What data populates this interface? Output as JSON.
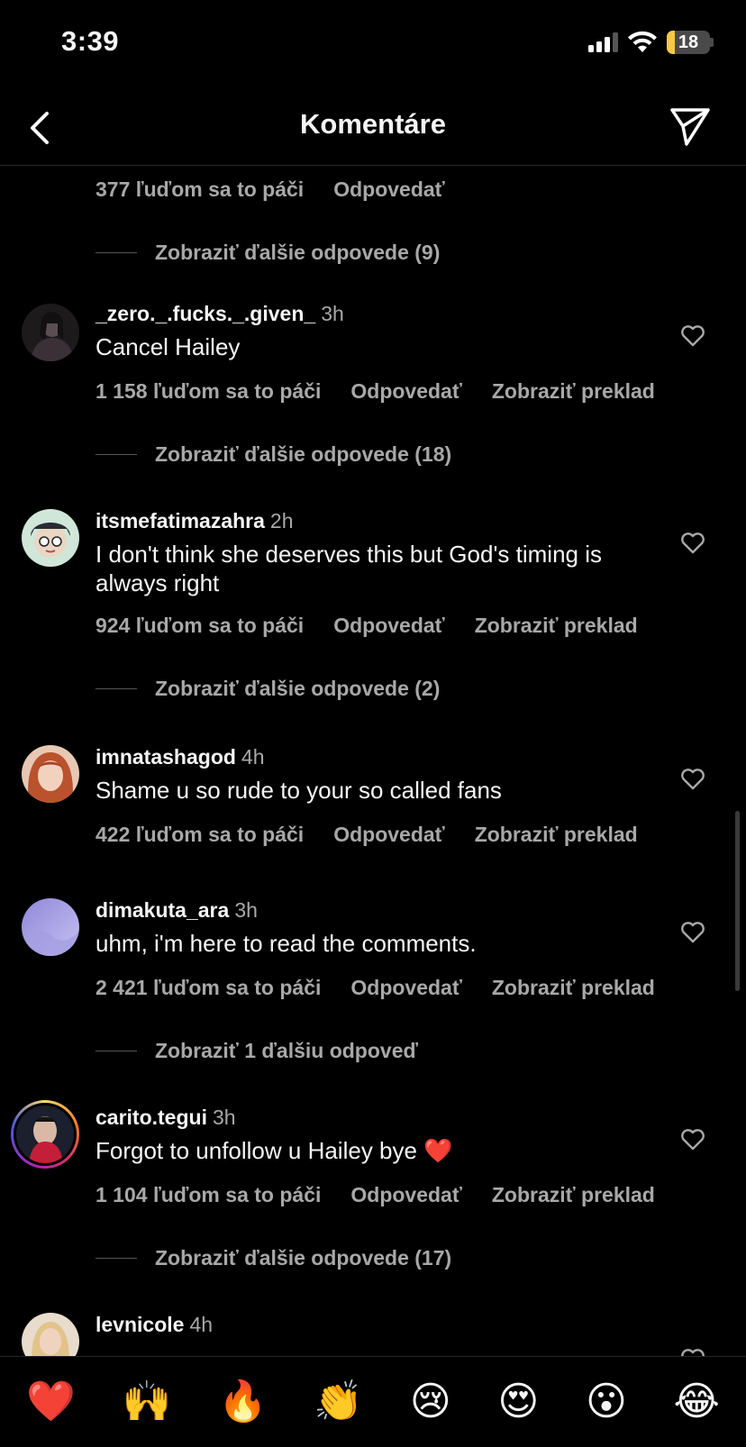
{
  "status": {
    "time": "3:39",
    "battery": "18",
    "battery_level": 0.18,
    "signal_bars": 3
  },
  "header": {
    "title": "Komentáre",
    "back_icon": "chevron-left-icon",
    "send_icon": "paper-plane-icon"
  },
  "top_meta": {
    "likes": "377 ľuďom sa to páči",
    "reply": "Odpovedať"
  },
  "top_more": "Zobraziť ďalšie odpovede (9)",
  "comments": [
    {
      "username": "_zero._.fucks._.given_",
      "time": "3h",
      "text": "Cancel Hailey",
      "likes": "1 158 ľuďom sa to páči",
      "reply": "Odpovedať",
      "translate": "Zobraziť preklad",
      "more_replies": "Zobraziť ďalšie odpovede (18)"
    },
    {
      "username": "itsmefatimazahra",
      "time": "2h",
      "text": "I don't think she deserves this but God's timing is always right",
      "likes": "924 ľuďom sa to páči",
      "reply": "Odpovedať",
      "translate": "Zobraziť preklad",
      "more_replies": "Zobraziť ďalšie odpovede (2)"
    },
    {
      "username": "imnatashagod",
      "time": "4h",
      "text": "Shame u so rude to your so called fans",
      "likes": "422 ľuďom sa to páči",
      "reply": "Odpovedať",
      "translate": "Zobraziť preklad"
    },
    {
      "username": "dimakuta_ara",
      "time": "3h",
      "text": "uhm, i'm here to read the comments.",
      "likes": "2 421 ľuďom sa to páči",
      "reply": "Odpovedať",
      "translate": "Zobraziť preklad",
      "more_replies": "Zobraziť 1 ďalšiu odpoveď"
    },
    {
      "username": "carito.tegui",
      "time": "3h",
      "text": "Forgot to unfollow u Hailey bye ❤️",
      "likes": "1 104 ľuďom sa to páči",
      "reply": "Odpovedať",
      "translate": "Zobraziť preklad",
      "more_replies": "Zobraziť ďalšie odpovede (17)"
    },
    {
      "username": "levnicole",
      "time": "4h"
    }
  ],
  "emoji_bar": [
    "❤️",
    "🙌",
    "🔥",
    "👏",
    "😢",
    "😍",
    "😮",
    "😂"
  ],
  "colors": {
    "background": "#000000",
    "text": "#f5f5f5",
    "secondary_text": "#a8a8a8",
    "battery_fill": "#f7c845"
  }
}
